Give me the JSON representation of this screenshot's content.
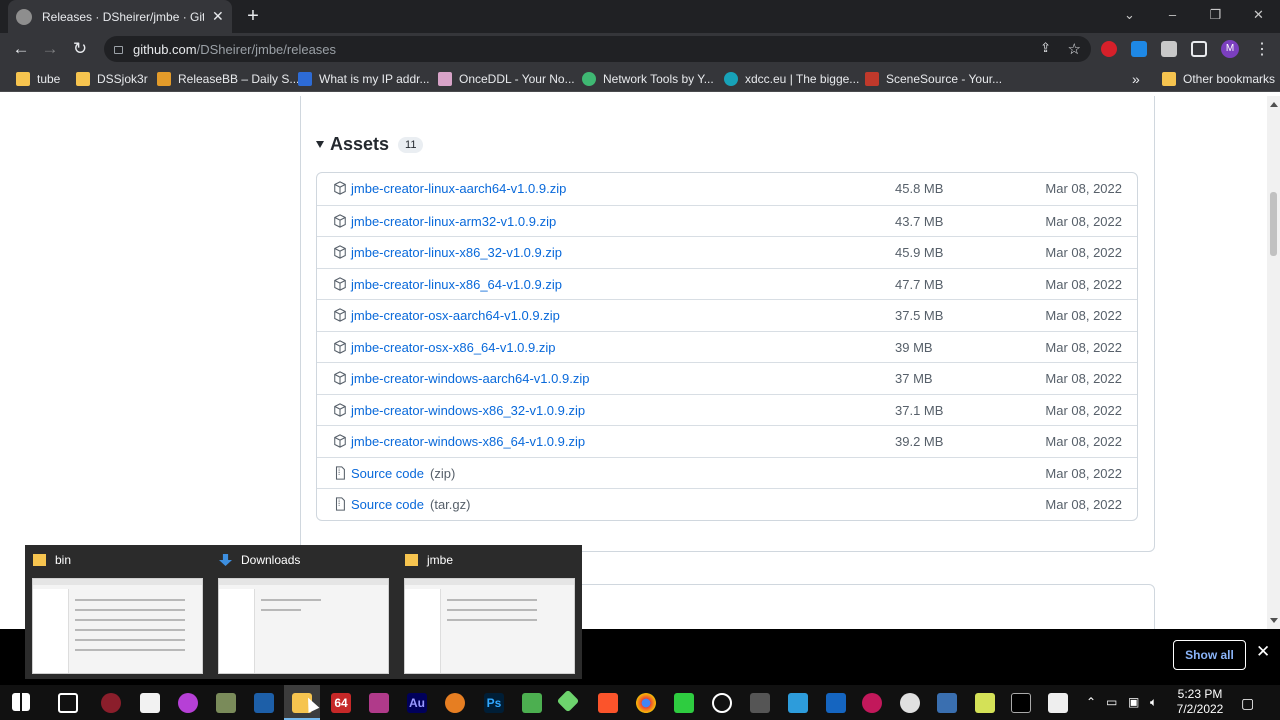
{
  "browser": {
    "tab_title": "Releases · DSheirer/jmbe · GitHub",
    "tab_close": "✕",
    "new_tab": "+",
    "url_host": "github.com",
    "url_path": "/DSheirer/jmbe/releases",
    "profile_initial": "M"
  },
  "bookmarks": [
    {
      "label": "tube",
      "icon": "folder-icon",
      "color": "#f6c44f"
    },
    {
      "label": "DSSjok3r",
      "icon": "folder-icon",
      "color": "#f6c44f"
    },
    {
      "label": "ReleaseBB – Daily S...",
      "icon": "releasebb-icon",
      "color": "#e39b2a"
    },
    {
      "label": "What is my IP addr...",
      "icon": "ip-icon",
      "color": "#2d6bd6"
    },
    {
      "label": "OnceDDL - Your No...",
      "icon": "onceddl-icon",
      "color": "#d8a3c8"
    },
    {
      "label": "Network Tools by Y...",
      "icon": "network-icon",
      "color": "#3fb873"
    },
    {
      "label": "xdcc.eu | The bigge...",
      "icon": "xdcc-icon",
      "color": "#17a2b8"
    },
    {
      "label": "SceneSource - Your...",
      "icon": "scenesource-icon",
      "color": "#c0392b"
    }
  ],
  "other_bookmarks": "Other bookmarks",
  "more_bookmarks": "»",
  "assets": {
    "title": "Assets",
    "count": "11",
    "rows": [
      {
        "name": "jmbe-creator-linux-aarch64-v1.0.9.zip",
        "sub": "",
        "size": "45.8 MB",
        "date": "Mar 08, 2022"
      },
      {
        "name": "jmbe-creator-linux-arm32-v1.0.9.zip",
        "sub": "",
        "size": "43.7 MB",
        "date": "Mar 08, 2022"
      },
      {
        "name": "jmbe-creator-linux-x86_32-v1.0.9.zip",
        "sub": "",
        "size": "45.9 MB",
        "date": "Mar 08, 2022"
      },
      {
        "name": "jmbe-creator-linux-x86_64-v1.0.9.zip",
        "sub": "",
        "size": "47.7 MB",
        "date": "Mar 08, 2022"
      },
      {
        "name": "jmbe-creator-osx-aarch64-v1.0.9.zip",
        "sub": "",
        "size": "37.5 MB",
        "date": "Mar 08, 2022"
      },
      {
        "name": "jmbe-creator-osx-x86_64-v1.0.9.zip",
        "sub": "",
        "size": "39 MB",
        "date": "Mar 08, 2022"
      },
      {
        "name": "jmbe-creator-windows-aarch64-v1.0.9.zip",
        "sub": "",
        "size": "37 MB",
        "date": "Mar 08, 2022"
      },
      {
        "name": "jmbe-creator-windows-x86_32-v1.0.9.zip",
        "sub": "",
        "size": "37.1 MB",
        "date": "Mar 08, 2022"
      },
      {
        "name": "jmbe-creator-windows-x86_64-v1.0.9.zip",
        "sub": "",
        "size": "39.2 MB",
        "date": "Mar 08, 2022"
      },
      {
        "name": "Source code",
        "sub": "(zip)",
        "size": "",
        "date": "Mar 08, 2022"
      },
      {
        "name": "Source code",
        "sub": "(tar.gz)",
        "size": "",
        "date": "Mar 08, 2022"
      }
    ]
  },
  "download_shelf": {
    "show_all": "Show all",
    "close": "✕"
  },
  "thumbnails": [
    {
      "label": "bin",
      "icon": "folder-icon"
    },
    {
      "label": "Downloads",
      "icon": "download-arrow-icon"
    },
    {
      "label": "jmbe",
      "icon": "folder-icon"
    }
  ],
  "taskbar": {
    "time": "5:23 PM",
    "date": "7/2/2022",
    "app_64_label": "64",
    "app_au_label": "Au",
    "app_ps_label": "Ps"
  }
}
